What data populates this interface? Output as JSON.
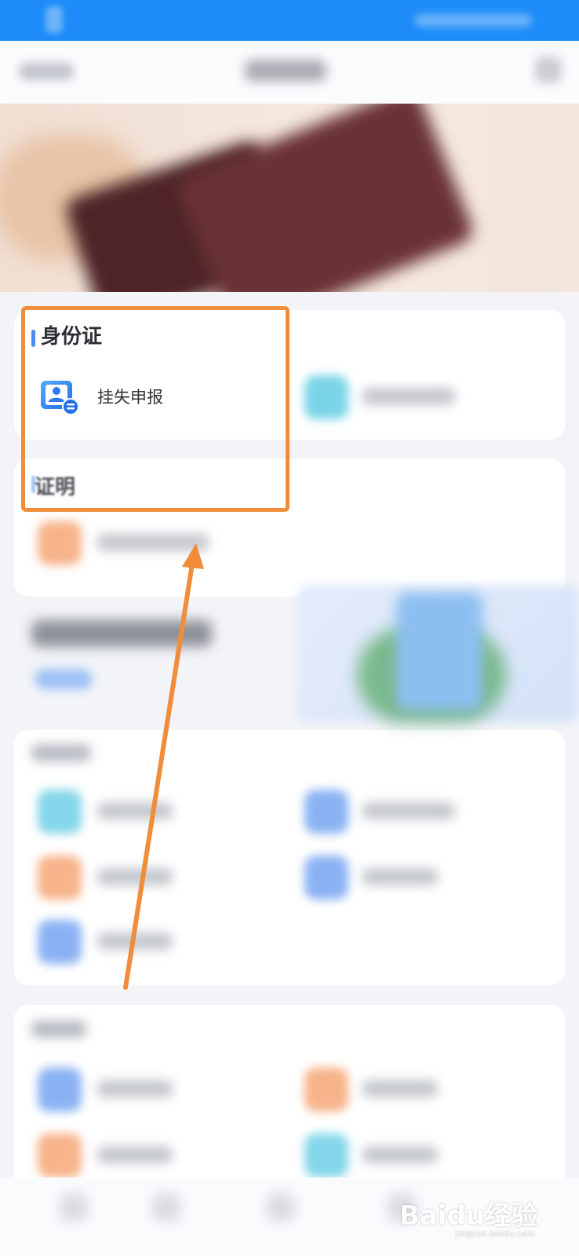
{
  "screen": {
    "accent_color": "#1d8cf8",
    "highlight_color": "#f08c3a"
  },
  "section_id": {
    "title": "身份证",
    "items": [
      {
        "label": "挂失申报",
        "icon": "id-card-icon"
      }
    ]
  },
  "section_cert": {
    "title": "证明"
  },
  "watermark": {
    "brand": "Baidu经验",
    "url": "jingyan.baidu.com"
  }
}
